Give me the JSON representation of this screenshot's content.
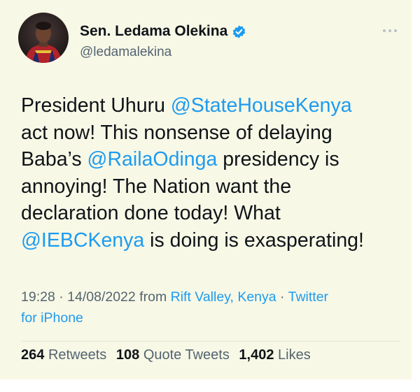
{
  "author": {
    "display_name": "Sen. Ledama Olekina",
    "handle": "@ledamalekina",
    "verified": true,
    "avatar_icon": "profile-photo"
  },
  "tweet": {
    "lines": [
      [
        {
          "text": "President Uhuru "
        },
        {
          "text": "@StateHouseKenya",
          "mention": true
        }
      ],
      [
        {
          "text": "act now! This nonsense of delaying"
        }
      ],
      [
        {
          "text": "Baba’s "
        },
        {
          "text": "@RailaOdinga",
          "mention": true
        },
        {
          "text": " presidency is"
        }
      ],
      [
        {
          "text": "annoying! The Nation want the"
        }
      ],
      [
        {
          "text": "declaration done today! What"
        }
      ],
      [
        {
          "text": "@IEBCKenya",
          "mention": true
        },
        {
          "text": " is doing is exasperating!"
        }
      ]
    ]
  },
  "meta": {
    "time": "19:28",
    "separator": " · ",
    "date": "14/08/2022",
    "from_label": " from ",
    "location": "Rift Valley, Kenya",
    "source_part1": "Twitter",
    "source_part2": "for iPhone"
  },
  "stats": {
    "retweets_count": "264",
    "retweets_label": "Retweets",
    "quotes_count": "108",
    "quotes_label": "Quote Tweets",
    "likes_count": "1,402",
    "likes_label": "Likes"
  },
  "colors": {
    "background": "#f8f8e6",
    "text": "#0f1419",
    "secondary": "#536471",
    "accent": "#1d9bf0"
  }
}
